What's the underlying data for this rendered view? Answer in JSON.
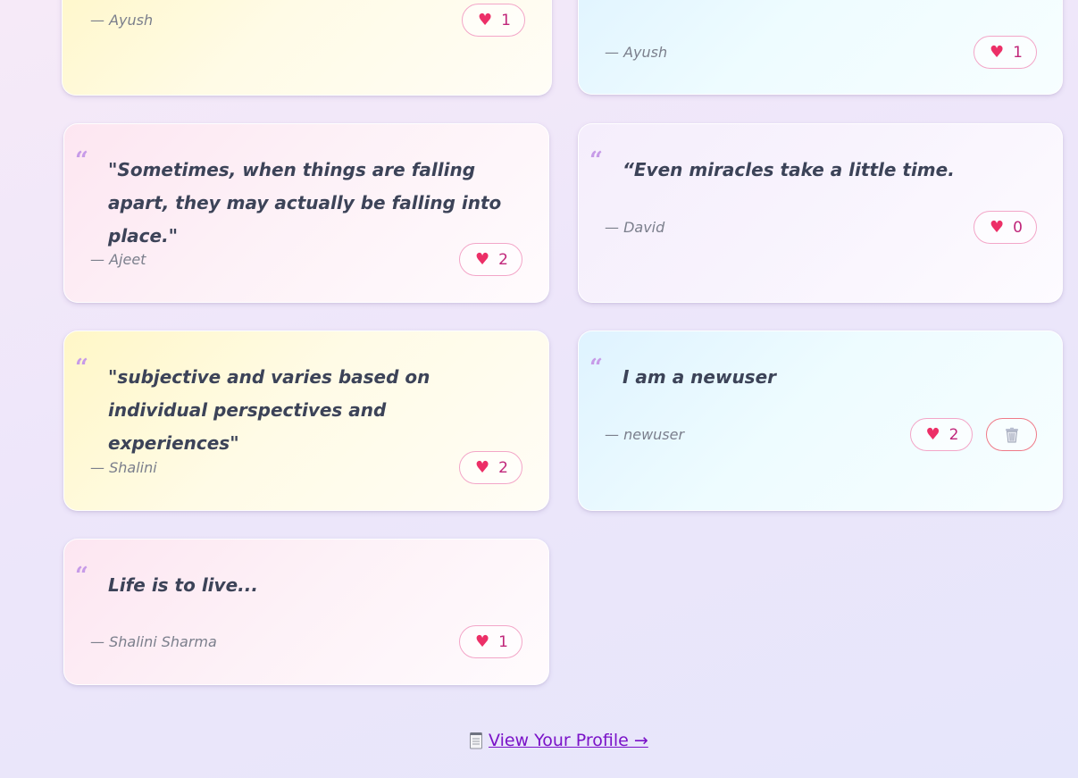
{
  "quotes": [
    {
      "text": "",
      "author": "— Ayush",
      "likes": "1"
    },
    {
      "text": "",
      "author": "— Ayush",
      "likes": "1"
    },
    {
      "text": "\"Sometimes, when things are falling apart, they may actually be falling into place.\"",
      "author": "— Ajeet",
      "likes": "2"
    },
    {
      "text": "“Even miracles take a little time.",
      "author": "— David",
      "likes": "0"
    },
    {
      "text": "\"subjective and varies based on individual perspectives and experiences\"",
      "author": "— Shalini",
      "likes": "2"
    },
    {
      "text": "I am a newuser",
      "author": "— newuser",
      "likes": "2"
    },
    {
      "text": "Life is to live...",
      "author": "— Shalini Sharma",
      "likes": "1"
    }
  ],
  "quote_mark": "“",
  "icons": {
    "like": "heart-icon",
    "delete": "trash-can-icon",
    "profile": "notepad-icon"
  },
  "profile_link": {
    "label": "View Your Profile →"
  },
  "colors": {
    "accent": "#7a12c8",
    "heart": "#ec2f67",
    "quote_mark": "#c79be8"
  }
}
